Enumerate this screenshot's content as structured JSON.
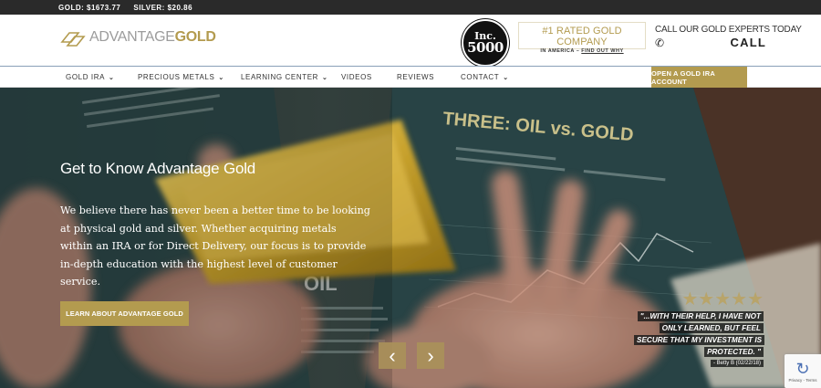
{
  "ticker": {
    "gold": "GOLD: $1673.77",
    "silver": "SILVER: $20.86"
  },
  "header": {
    "logo": {
      "text_regular": "ADVANTAGE",
      "text_bold": "GOLD"
    },
    "inc_badge": {
      "line1": "Inc.",
      "line2": "5000"
    },
    "rated": {
      "title": "#1 RATED GOLD COMPANY",
      "subtitle_prefix": "IN AMERICA – ",
      "subtitle_link": "FIND OUT WHY"
    },
    "callus": {
      "text": "CALL OUR GOLD EXPERTS TODAY",
      "phone_icon": "phone-icon",
      "call_label": "CALL"
    }
  },
  "nav": {
    "items": [
      {
        "label": "GOLD IRA",
        "has_dropdown": true
      },
      {
        "label": "PRECIOUS METALS",
        "has_dropdown": true
      },
      {
        "label": "LEARNING CENTER",
        "has_dropdown": true
      },
      {
        "label": "VIDEOS",
        "has_dropdown": false
      },
      {
        "label": "REVIEWS",
        "has_dropdown": false
      },
      {
        "label": "CONTACT",
        "has_dropdown": true
      }
    ],
    "cta": "OPEN A GOLD IRA ACCOUNT"
  },
  "hero": {
    "title": "Get to Know Advantage Gold",
    "body": "We believe there has never been a better time to be looking at physical gold and silver. Whether acquiring metals within an IRA or for Direct Delivery, our focus is to provide in-depth education with the highest level of customer service.",
    "button": "LEARN ABOUT ADVANTAGE GOLD",
    "prev_arrow": "‹",
    "next_arrow": "›",
    "background_text": {
      "heading": "THREE: OIL vs. GOLD",
      "oil_label": "OIL"
    },
    "review": {
      "stars": "★★★★★",
      "rating": 5,
      "quote": "\"...WITH THEIR HELP, I HAVE NOT ONLY LEARNED, BUT FEEL SECURE THAT MY INVESTMENT IS PROTECTED. \"",
      "author": "- Betty B (02/22/18)"
    },
    "recaptcha": {
      "text": "Privacy - Terms"
    }
  },
  "colors": {
    "gold_accent": "#b39b4f",
    "ticker_bg": "#2a2a2a",
    "nav_border": "#8aa0b8"
  }
}
